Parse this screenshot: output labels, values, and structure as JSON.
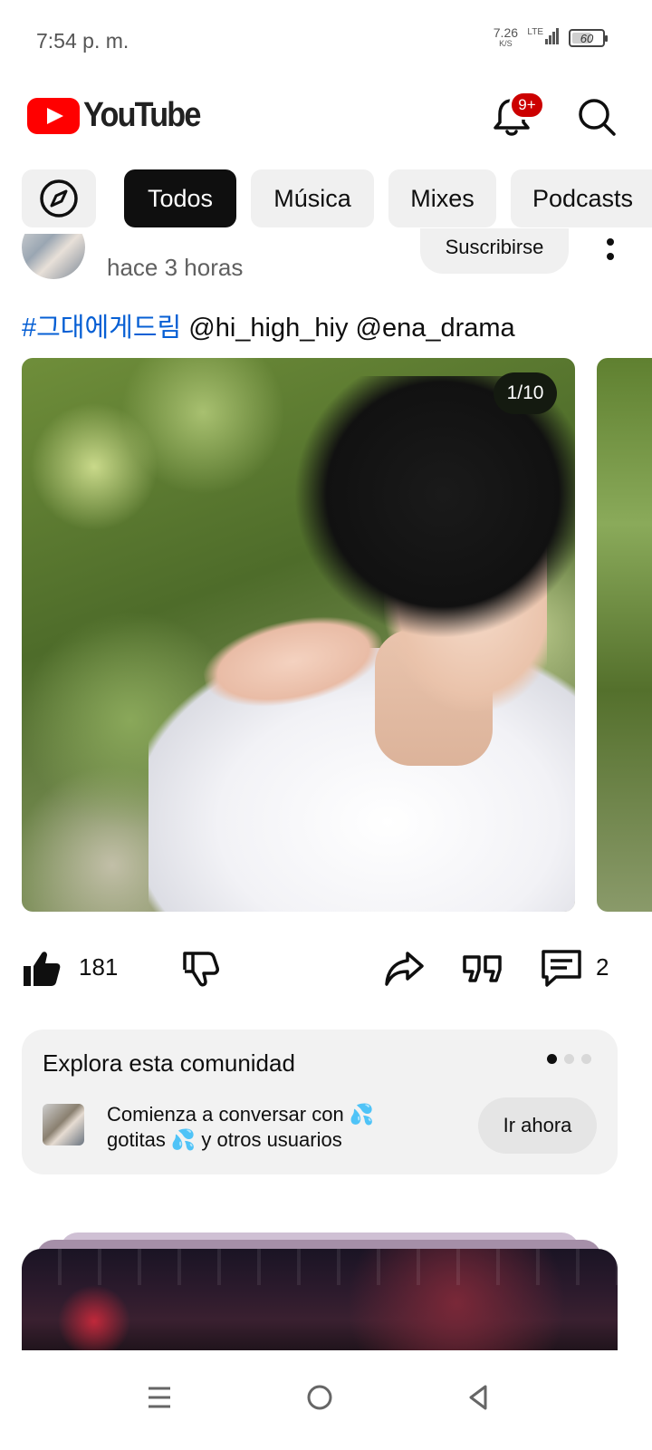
{
  "status_bar": {
    "time": "7:54 p. m.",
    "net_speed_value": "7.26",
    "net_speed_unit": "K/S",
    "network": "LTE",
    "battery": "60"
  },
  "top_bar": {
    "logo_text": "YouTube",
    "notification_badge": "9+"
  },
  "chips": [
    {
      "label": "Todos",
      "active": true
    },
    {
      "label": "Música",
      "active": false
    },
    {
      "label": "Mixes",
      "active": false
    },
    {
      "label": "Podcasts",
      "active": false
    }
  ],
  "post": {
    "time_ago": "hace 3 horas",
    "subscribe_label": "Suscribirse",
    "hashtag": "#그대에게드림",
    "mentions": " @hi_high_hiy @ena_drama",
    "image_counter": "1/10",
    "likes": "181",
    "comments": "2"
  },
  "community": {
    "title": "Explora esta comunidad",
    "text": "Comienza a conversar con 💦 gotitas 💦 y otros usuarios",
    "button_label": "Ir ahora",
    "page_count": 3,
    "active_page": 1
  },
  "colors": {
    "brand_red": "#ff0000",
    "hashtag_blue": "#065fd4",
    "badge_red": "#cc0000"
  }
}
